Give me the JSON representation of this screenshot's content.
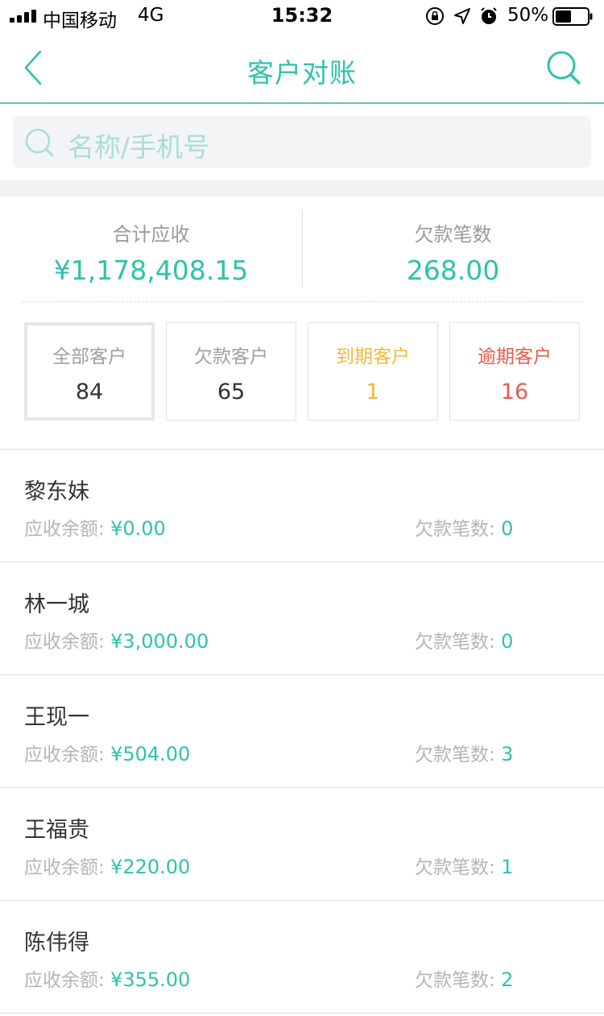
{
  "status_bar": {
    "carrier": "中国移动",
    "network": "4G",
    "time": "15:32",
    "battery_percent": "50%",
    "battery_level": 0.5
  },
  "nav": {
    "title": "客户对账",
    "back_icon": "chevron-left-icon",
    "search_icon": "search-icon"
  },
  "search": {
    "placeholder": "名称/手机号"
  },
  "summary": {
    "total_receivable_label": "合计应收",
    "total_receivable_value": "¥1,178,408.15",
    "debt_count_label": "欠款笔数",
    "debt_count_value": "268.00"
  },
  "filters": [
    {
      "label": "全部客户",
      "count": "84",
      "selected": true
    },
    {
      "label": "欠款客户",
      "count": "65",
      "selected": false
    },
    {
      "label": "到期客户",
      "count": "1",
      "selected": false
    },
    {
      "label": "逾期客户",
      "count": "16",
      "selected": false
    }
  ],
  "customers": [
    {
      "name": "黎东妹",
      "balance_label": "应收余额:",
      "balance": "¥0.00",
      "debt_label": "欠款笔数:",
      "debt_count": "0"
    },
    {
      "name": "林一城",
      "balance_label": "应收余额:",
      "balance": "¥3,000.00",
      "debt_label": "欠款笔数:",
      "debt_count": "0"
    },
    {
      "name": "王现一",
      "balance_label": "应收余额:",
      "balance": "¥504.00",
      "debt_label": "欠款笔数:",
      "debt_count": "3"
    },
    {
      "name": "王福贵",
      "balance_label": "应收余额:",
      "balance": "¥220.00",
      "debt_label": "欠款笔数:",
      "debt_count": "1"
    },
    {
      "name": "陈伟得",
      "balance_label": "应收余额:",
      "balance": "¥355.00",
      "debt_label": "欠款笔数:",
      "debt_count": "2"
    }
  ],
  "colors": {
    "accent": "#2fc2ab",
    "due": "#f1b93a",
    "overdue": "#e35c4e",
    "muted": "#9b9b9b"
  }
}
